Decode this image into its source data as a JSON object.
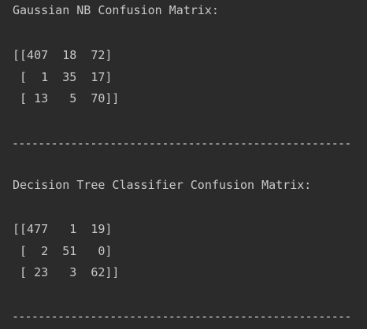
{
  "console": {
    "gaussian_title": "Gaussian NB Confusion Matrix:",
    "gaussian_matrix": [
      "[[407  18  72]",
      " [  1  35  17]",
      " [ 13   5  70]]"
    ],
    "separator_1": "----------------------------------------------------",
    "tree_title": "Decision Tree Classifier Confusion Matrix:",
    "tree_matrix": [
      "[[477   1  19]",
      " [  2  51   0]",
      " [ 23   3  62]]"
    ],
    "separator_2": "----------------------------------------------------"
  }
}
